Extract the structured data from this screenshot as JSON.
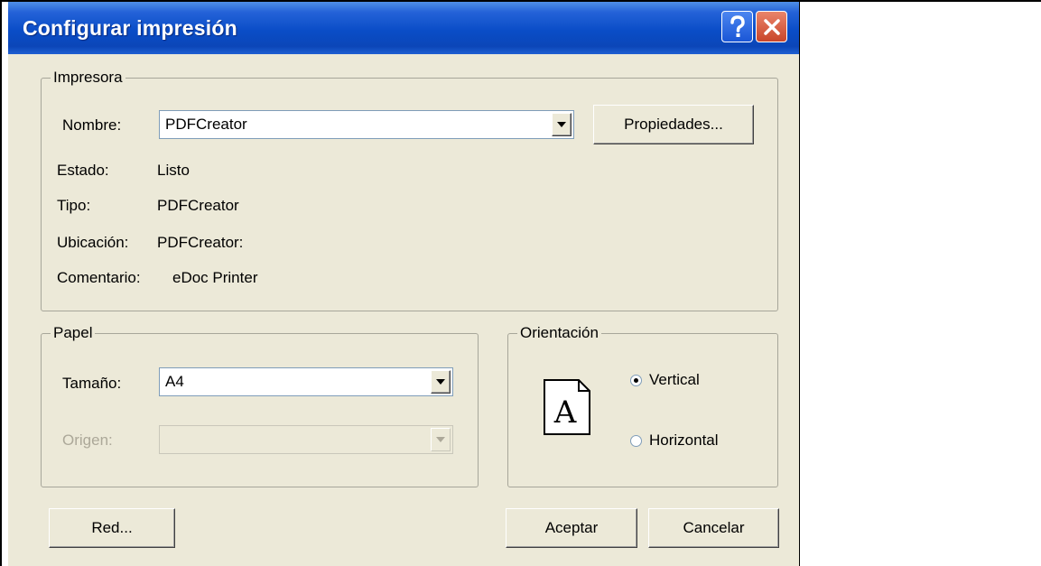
{
  "window": {
    "title": "Configurar impresión"
  },
  "titlebar_icons": {
    "help": "help-icon",
    "close": "close-icon"
  },
  "printer": {
    "legend": "Impresora",
    "name_label": "Nombre:",
    "name_value": "PDFCreator",
    "properties_button": "Propiedades...",
    "status_label": "Estado:",
    "status_value": "Listo",
    "type_label": "Tipo:",
    "type_value": "PDFCreator",
    "location_label": "Ubicación:",
    "location_value": "PDFCreator:",
    "comment_label": "Comentario:",
    "comment_value": "eDoc Printer"
  },
  "paper": {
    "legend": "Papel",
    "size_label": "Tamaño:",
    "size_value": "A4",
    "source_label": "Origen:",
    "source_value": ""
  },
  "orientation": {
    "legend": "Orientación",
    "icon": "portrait-page-icon",
    "icon_letter": "A",
    "portrait_label": "Vertical",
    "landscape_label": "Horizontal",
    "selected": "Vertical"
  },
  "buttons": {
    "network": "Red...",
    "ok": "Aceptar",
    "cancel": "Cancelar"
  },
  "colors": {
    "titlebar": "#0a4dc7",
    "dialog_bg": "#ece9d8",
    "close_button": "#c9452a"
  }
}
